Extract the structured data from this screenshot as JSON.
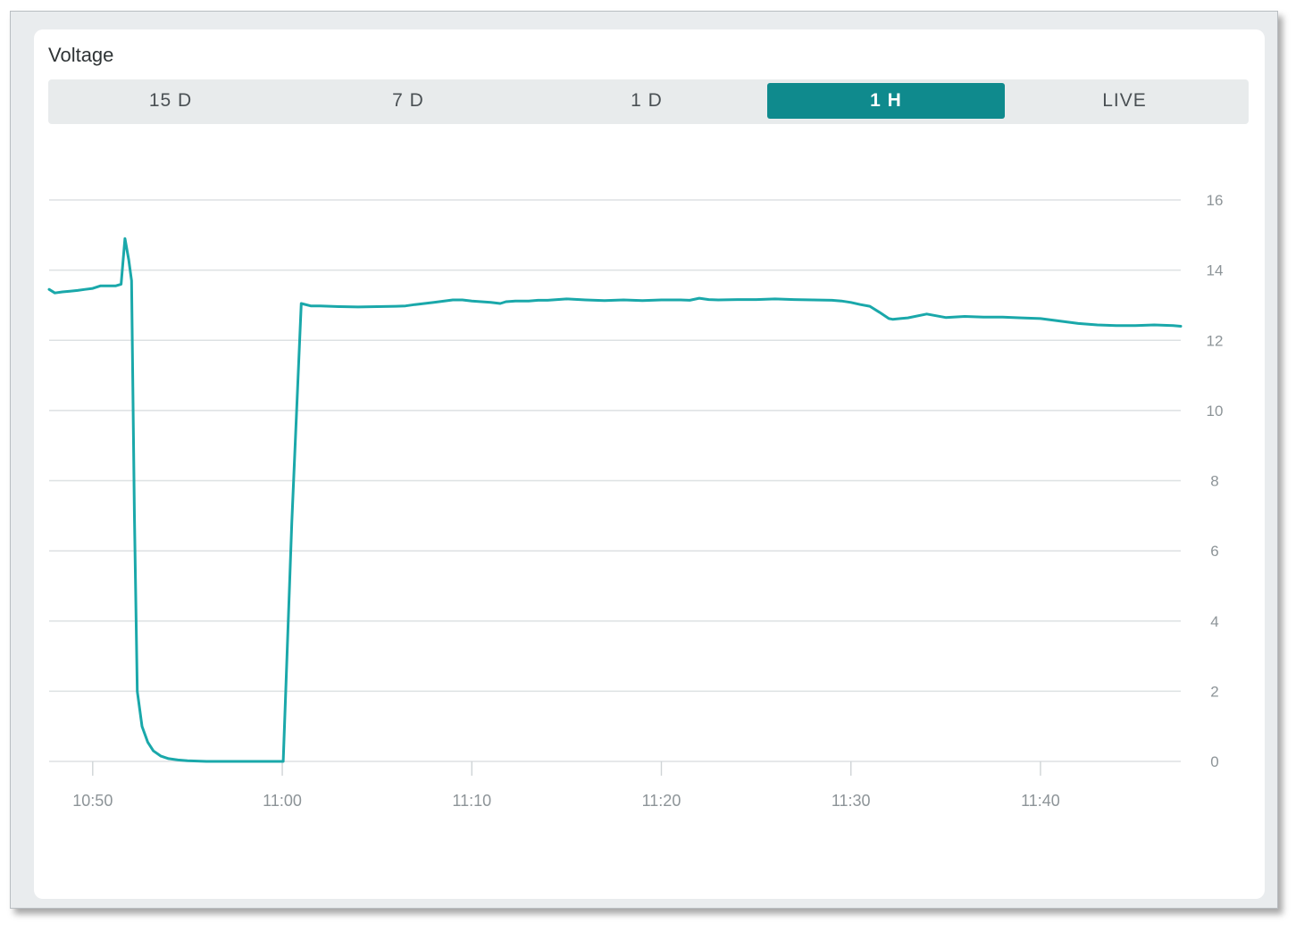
{
  "card": {
    "title": "Voltage"
  },
  "range_tabs": [
    {
      "label": "15 D",
      "active": false
    },
    {
      "label": "7 D",
      "active": false
    },
    {
      "label": "1 D",
      "active": false
    },
    {
      "label": "1 H",
      "active": true
    },
    {
      "label": "LIVE",
      "active": false
    }
  ],
  "colors": {
    "accent": "#0f8a8d",
    "line": "#1aa8aa",
    "grid": "#dde1e3"
  },
  "chart_data": {
    "type": "line",
    "title": "Voltage",
    "xlabel": "",
    "ylabel": "",
    "y_axis_side": "right",
    "grid": true,
    "ylim": [
      0,
      16
    ],
    "yticks": [
      0,
      2,
      4,
      6,
      8,
      10,
      12,
      14,
      16
    ],
    "ytick_labels": [
      "0",
      "2",
      "4",
      "6",
      "8",
      "10",
      "12",
      "14",
      "16"
    ],
    "xlim_minutes": [
      -2.3,
      57.4
    ],
    "xticks_minutes": [
      0,
      10,
      20,
      30,
      40,
      50
    ],
    "xtick_labels": [
      "10:50",
      "11:00",
      "11:10",
      "11:20",
      "11:30",
      "11:40"
    ],
    "series": [
      {
        "x_minutes": [
          -2.3,
          -2.0,
          -1.6,
          -1.2,
          -0.8,
          -0.4,
          0.0,
          0.4,
          0.8,
          1.2,
          1.5,
          1.7,
          1.9,
          2.05,
          2.2,
          2.35,
          2.6,
          2.9,
          3.2,
          3.6,
          4.0,
          4.5,
          5.0,
          5.5,
          6.0,
          7.0,
          8.0,
          9.0,
          10.0,
          10.05,
          10.5,
          11.0,
          11.5,
          12.0,
          12.5,
          13.0,
          14.0,
          15.0,
          16.0,
          16.5,
          17.0,
          18.0,
          19.0,
          19.5,
          20.0,
          20.5,
          21.0,
          21.5,
          21.8,
          22.3,
          23.0,
          23.5,
          24.0,
          24.5,
          25.0,
          26.0,
          27.0,
          28.0,
          29.0,
          30.0,
          31.0,
          31.5,
          32.0,
          32.5,
          33.0,
          34.0,
          35.0,
          36.0,
          37.0,
          38.0,
          39.0,
          39.5,
          40.0,
          40.5,
          41.0,
          41.5,
          42.0,
          42.2,
          42.6,
          43.0,
          44.0,
          45.0,
          46.0,
          47.0,
          48.0,
          49.0,
          50.0,
          51.0,
          52.0,
          53.0,
          54.0,
          55.0,
          56.0,
          57.0,
          57.4
        ],
        "y": [
          13.45,
          13.35,
          13.38,
          13.4,
          13.42,
          13.45,
          13.48,
          13.55,
          13.55,
          13.55,
          13.6,
          14.9,
          14.3,
          13.7,
          7.0,
          2.0,
          1.0,
          0.55,
          0.3,
          0.15,
          0.08,
          0.04,
          0.02,
          0.01,
          0.0,
          0.0,
          0.0,
          0.0,
          0.0,
          0.0,
          6.8,
          13.05,
          12.98,
          12.98,
          12.97,
          12.96,
          12.95,
          12.96,
          12.97,
          12.98,
          13.02,
          13.08,
          13.15,
          13.15,
          13.12,
          13.1,
          13.08,
          13.05,
          13.1,
          13.12,
          13.12,
          13.14,
          13.14,
          13.16,
          13.18,
          13.15,
          13.13,
          13.15,
          13.13,
          13.15,
          13.15,
          13.14,
          13.2,
          13.16,
          13.15,
          13.16,
          13.16,
          13.18,
          13.16,
          13.15,
          13.14,
          13.12,
          13.08,
          13.02,
          12.97,
          12.8,
          12.62,
          12.6,
          12.62,
          12.64,
          12.75,
          12.65,
          12.68,
          12.66,
          12.66,
          12.64,
          12.62,
          12.55,
          12.48,
          12.44,
          12.42,
          12.42,
          12.44,
          12.42,
          12.4
        ]
      }
    ]
  }
}
